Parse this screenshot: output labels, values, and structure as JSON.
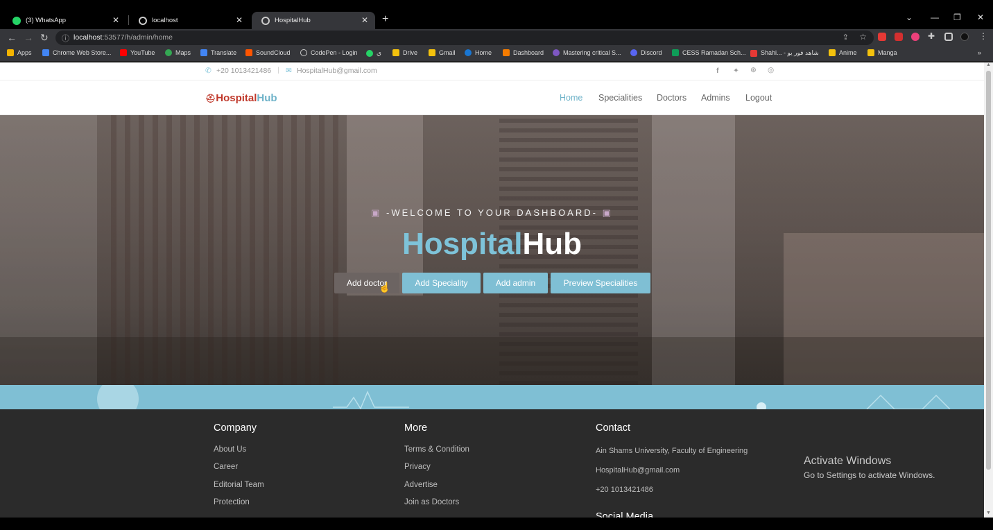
{
  "browser": {
    "tabs": [
      {
        "title": "(3) WhatsApp"
      },
      {
        "title": "localhost"
      },
      {
        "title": "HospitalHub"
      }
    ],
    "url_host": "localhost",
    "url_path": ":53577/h/admin/home",
    "bookmarks": [
      "Apps",
      "Chrome Web Store...",
      "YouTube",
      "Maps",
      "Translate",
      "SoundCloud",
      "CodePen - Login",
      "ي",
      "Drive",
      "Gmail",
      "Home",
      "Dashboard",
      "Mastering critical S...",
      "Discord",
      "CESS Ramadan Sch...",
      "Shahi... - شاهد فور يو",
      "Anime",
      "Manga"
    ],
    "bookmarks_more": "»"
  },
  "topbar": {
    "phone": "+20 1013421486",
    "email": "HospitalHub@gmail.com",
    "social": [
      "facebook-icon",
      "twitter-icon",
      "dribbble-icon",
      "instagram-icon"
    ]
  },
  "nav": {
    "logo_a": "Hospital",
    "logo_b": "Hub",
    "links": [
      "Home",
      "Specialities",
      "Doctors",
      "Admins",
      "Logout"
    ]
  },
  "hero": {
    "welcome": "-WELCOME TO YOUR DASHBOARD-",
    "title_a": "Hospital",
    "title_b": "Hub",
    "buttons": [
      "Add doctor",
      "Add Speciality",
      "Add admin",
      "Preview Specialities"
    ]
  },
  "footer": {
    "company_title": "Company",
    "company": [
      "About Us",
      "Career",
      "Editorial Team",
      "Protection"
    ],
    "more_title": "More",
    "more": [
      "Terms & Condition",
      "Privacy",
      "Advertise",
      "Join as Doctors"
    ],
    "contact_title": "Contact",
    "contact": [
      "Ain Shams University, Faculty of Engineering",
      "HospitalHub@gmail.com",
      "+20 1013421486"
    ],
    "social_title": "Social Media"
  },
  "overlay": {
    "activate_title": "Activate Windows",
    "activate_sub": "Go to Settings to activate Windows."
  },
  "colors": {
    "accent": "#7ec3d9",
    "logo_red": "#c0392b",
    "footer_bg": "#2b2b2b",
    "band": "#7fbfd4"
  }
}
